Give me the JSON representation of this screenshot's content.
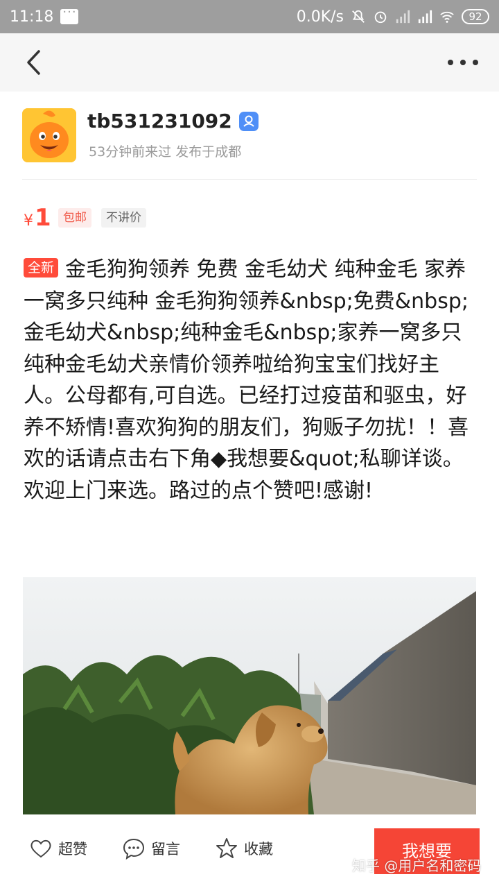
{
  "status_bar": {
    "time": "11:18",
    "network_speed": "0.0K/s",
    "battery": "92"
  },
  "seller": {
    "username": "tb531231092",
    "meta": "53分钟前来过 发布于成都"
  },
  "price": {
    "currency": "¥",
    "amount": "1",
    "tags": [
      "包邮",
      "不讲价"
    ]
  },
  "listing": {
    "condition_badge": "全新",
    "description": "金毛狗狗领养 免费 金毛幼犬 纯种金毛 家养一窝多只纯种  金毛狗狗领养&nbsp;免费&nbsp;金毛幼犬&nbsp;纯种金毛&nbsp;家养一窝多只纯种金毛幼犬亲情价领养啦给狗宝宝们找好主人。公母都有,可自选。已经打过疫苗和驱虫，好养不矫情!喜欢狗狗的朋友们，狗贩子勿扰！！喜欢的话请点击右下角◆我想要&quot;私聊详谈。欢迎上门来选。路过的点个赞吧!感谢!"
  },
  "actions": {
    "like_label": "超赞",
    "comment_label": "留言",
    "favorite_label": "收藏",
    "want_label": "我想要"
  },
  "watermark": "知乎 @用户名和密码",
  "colors": {
    "accent": "#f54536",
    "price": "#ff4b3a",
    "status_bar": "#9e9e9e",
    "verify": "#4f8ff7"
  }
}
